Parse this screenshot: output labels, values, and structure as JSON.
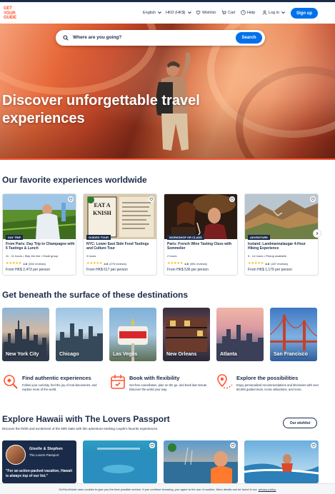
{
  "logo": {
    "lines": [
      "GET",
      "YOUR",
      "GUIDE"
    ]
  },
  "header": {
    "language": "English",
    "currency": "HKD (HK$)",
    "wishlist": "Wishlist",
    "cart": "Cart",
    "help": "Help",
    "login": "Log in",
    "signup": "Sign up"
  },
  "search": {
    "placeholder": "Where are you going?",
    "button": "Search"
  },
  "hero": {
    "title": "Discover unforgettable travel experiences"
  },
  "favorites": {
    "heading": "Our favorite experiences worldwide",
    "cards": [
      {
        "tag": "DAY TRIP",
        "title": "From Paris: Day Trip to Champagne with 6 Tastings & Lunch",
        "meta": "11 - 11 hours • Skip the line • Small group",
        "rating": "4.8",
        "reviews": "(532 reviews)",
        "price": "From HK$ 2,473 per person"
      },
      {
        "tag": "GUIDED TOUR",
        "title": "NYC: Lower East Side Food Tastings and Culture Tour",
        "meta": "3 hours",
        "rating": "4.8",
        "reviews": "(275 reviews)",
        "price": "From HK$ 617 per person"
      },
      {
        "tag": "WORKSHOP OR CLASS",
        "title": "Paris: French Wine Tasting Class with Sommelier",
        "meta": "2 hours",
        "rating": "4.8",
        "reviews": "(891 reviews)",
        "price": "From HK$ 536 per person"
      },
      {
        "tag": "ADVENTURE",
        "title": "Iceland: Landmannalaugar 4-Hour Hiking Experience",
        "meta": "5 - 14 hours • Pickup available",
        "rating": "4.8",
        "reviews": "(187 reviews)",
        "price": "From HK$ 1,179 per person"
      }
    ]
  },
  "destinations": {
    "heading": "Get beneath the surface of these destinations",
    "items": [
      "New York City",
      "Chicago",
      "Las Vegas",
      "New Orleans",
      "Atlanta",
      "San Francisco"
    ]
  },
  "features": [
    {
      "title": "Find authentic experiences",
      "desc": "Follow your curiosity, feel the joy of real discoveries, and explore more of the world."
    },
    {
      "title": "Book with flexibility",
      "desc": "Get free cancellation, plan on the go, and book last minute. Discover the world your way."
    },
    {
      "title": "Explore the possibilities",
      "desc": "Enjoy personalized recommendations and itineraries with over 60,000 guided tours, iconic attractions, and more."
    }
  ],
  "hawaii": {
    "heading": "Explore Hawaii with The Lovers Passport",
    "subtitle": "Discover the thrills and excitement of the 50th state with this adventure-seeking couple's favorite experiences.",
    "wishlist_button": "Our wishlist",
    "profile_name": "Giselle & Stephen",
    "profile_sub": "The Lovers Passport",
    "quote": "\"For an action-packed vacation, Hawaii is always top of our list.\""
  },
  "cookie": {
    "text": "GetYourGuide uses cookies to give you the best possible service. If you continue browsing, you agree to the use of cookies. More details can be found in our",
    "link": "privacy policy."
  },
  "colors": {
    "brand": "#ff5533",
    "primary": "#0071eb",
    "navy": "#1a2b49",
    "star": "#ffb400"
  }
}
